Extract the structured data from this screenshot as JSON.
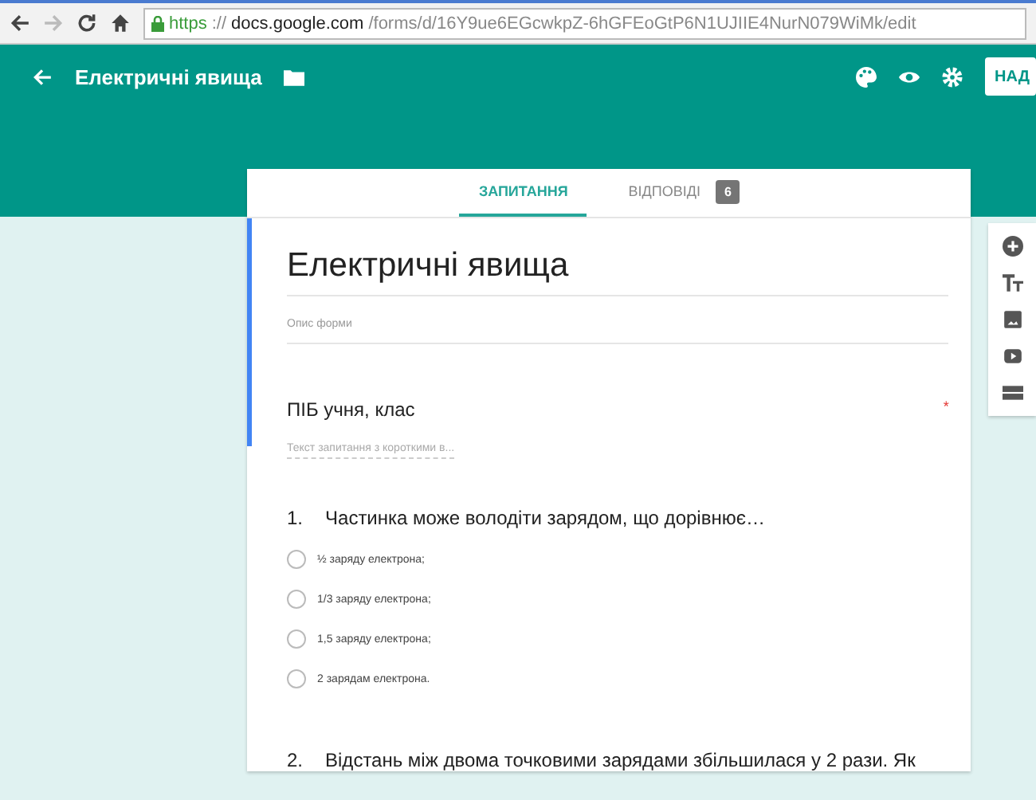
{
  "browser": {
    "url_scheme": "https",
    "url_separator": "://",
    "url_host": "docs.google.com",
    "url_path": "/forms/d/16Y9ue6EGcwkpZ-6hGFEoGtP6N1UJIIE4NurN079WiMk/edit"
  },
  "header": {
    "title": "Електричні явища",
    "send_button": "НАД"
  },
  "tabs": [
    {
      "label": "ЗАПИТАННЯ",
      "selected": true
    },
    {
      "label": "ВІДПОВІДІ",
      "selected": false,
      "badge": "6"
    }
  ],
  "form": {
    "title": "Електричні явища",
    "description_placeholder": "Опис форми"
  },
  "questions": [
    {
      "kind": "short",
      "title": "ПІБ учня, клас",
      "required": true,
      "required_mark": "*",
      "answer_placeholder": "Текст запитання з короткими в..."
    },
    {
      "kind": "choice",
      "number": "1.",
      "title": "Частинка може володіти зарядом, що дорівнює…",
      "options": [
        {
          "label": "½ заряду електрона;",
          "selected": false
        },
        {
          "label": "1/3 заряду електрона;",
          "selected": false
        },
        {
          "label": "1,5 заряду електрона;",
          "selected": false
        },
        {
          "label": "2 зарядам електрона.",
          "selected": false
        }
      ]
    },
    {
      "kind": "choice",
      "number": "2.",
      "title": "Відстань між двома точковими зарядами збільшилася у 2 рази. Як"
    }
  ]
}
